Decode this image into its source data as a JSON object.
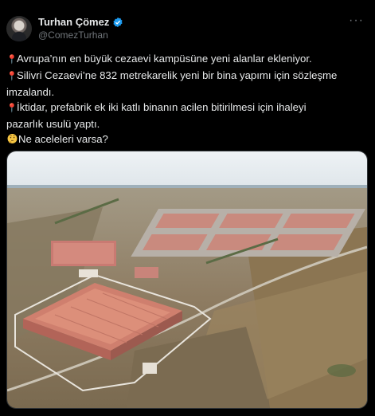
{
  "tweet": {
    "display_name": "Turhan Çömez",
    "handle": "@ComezTurhan",
    "lines": [
      {
        "icon": "pin",
        "text": "Avrupa’nın en büyük cezaevi kampüsüne yeni alanlar ekleniyor."
      },
      {
        "icon": "pin",
        "text": "Silivri Cezaevi’ne 832 metrekarelik yeni bir bina yapımı için sözleşme"
      },
      {
        "icon": "",
        "text": "imzalandı."
      },
      {
        "icon": "pin",
        "text": "İktidar, prefabrik ek iki katlı binanın acilen bitirilmesi için ihaleyi"
      },
      {
        "icon": "",
        "text": "pazarlık usulü yaptı."
      },
      {
        "icon": "thinking-face",
        "text": "Ne aceleleri varsa?"
      }
    ],
    "photo_alt": "aerial-prison-campus-photo",
    "colors": {
      "verified": "#1d9bf0",
      "pin": "#f04a4a",
      "text": "#e7e9ea",
      "secondary": "#71767b"
    }
  }
}
